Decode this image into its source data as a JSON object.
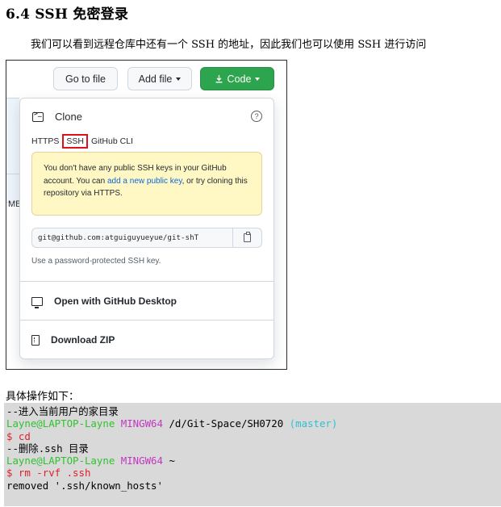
{
  "heading": "6.4 SSH 免密登录",
  "intro": "我们可以看到远程仓库中还有一个 SSH 的地址，因此我们也可以使用 SSH 进行访问",
  "screenshot": {
    "bg_text": "ME.",
    "buttons": {
      "goto_file": "Go to file",
      "add_file": "Add file",
      "code": "Code"
    },
    "clone": {
      "title": "Clone",
      "tabs": [
        "HTTPS",
        "SSH",
        "GitHub CLI"
      ],
      "warning_prefix": "You don't have any public SSH keys in your GitHub account. You can ",
      "warning_link": "add a new public key",
      "warning_suffix": ", or try cloning this repository via HTTPS.",
      "url": "git@github.com:atguiguyueyue/git-shT",
      "url_hint": "Use a password-protected SSH key.",
      "open_desktop": "Open with GitHub Desktop",
      "download_zip": "Download ZIP"
    }
  },
  "steps_label": "具体操作如下：",
  "terminal": {
    "comment1": "--进入当前用户的家目录",
    "prompt_user": "Layne@LAPTOP-Layne",
    "prompt_shell": "MINGW64",
    "path1": "/d/Git-Space/SH0720",
    "branch": "(master)",
    "cmd1": "$ cd",
    "comment2": "--删除.ssh 目录",
    "path2": "~",
    "cmd2": "$ rm -rvf .ssh",
    "output": "removed '.ssh/known_hosts'"
  }
}
